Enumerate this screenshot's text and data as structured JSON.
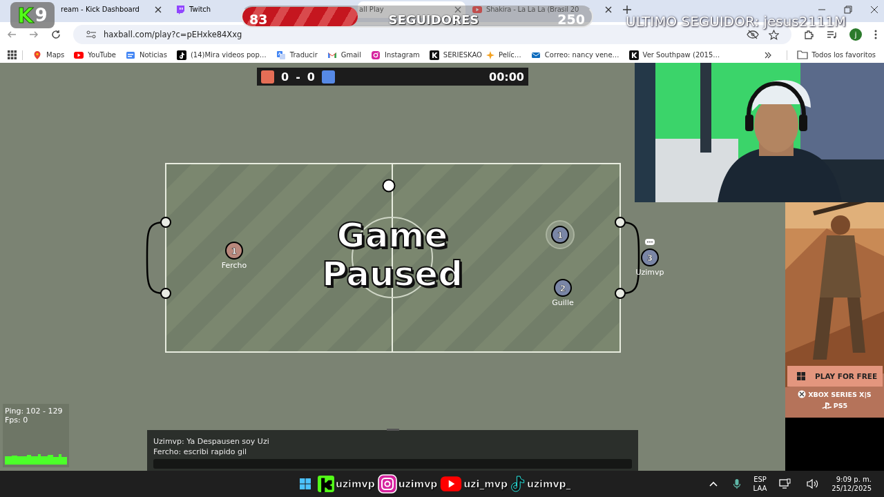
{
  "browser": {
    "tabs": [
      {
        "label": "ream - Kick Dashboard",
        "selected": false,
        "closable": true
      },
      {
        "label": "Twitch",
        "kind": "twitch",
        "selected": false,
        "closable": false
      },
      {
        "label": "all Play",
        "selected": true,
        "closable": true
      },
      {
        "label": "Shakira - La La La (Brasil 20",
        "kind": "youtube",
        "selected": false,
        "closable": true
      }
    ],
    "url": "haxball.com/play?c=pEHxke84Xxg",
    "profile_initial": "j",
    "bookmarks": [
      {
        "label": "Maps",
        "kind": "maps"
      },
      {
        "label": "YouTube",
        "kind": "youtube"
      },
      {
        "label": "Noticias",
        "kind": "news"
      },
      {
        "label": "(14)Mira videos pop…",
        "kind": "tiktok"
      },
      {
        "label": "Traducir",
        "kind": "translate"
      },
      {
        "label": "Gmail",
        "kind": "gmail"
      },
      {
        "label": "Instagram",
        "kind": "instagram"
      },
      {
        "label": "SERIESKAO",
        "label_2": "Pelíc…",
        "kind": "k"
      },
      {
        "label": "Correo: nancy vene…",
        "kind": "mail"
      },
      {
        "label": "Ver Southpaw (2015…",
        "kind": "k"
      }
    ],
    "all_bookmarks": "Todos los favoritos"
  },
  "game": {
    "score": {
      "red": "0",
      "separator": "-",
      "blue": "0",
      "time": "00:00"
    },
    "status": "Game Paused",
    "players": [
      {
        "kind": "red",
        "number": "1",
        "name": "Fercho",
        "highlighted": false,
        "typing": false
      },
      {
        "kind": "blue",
        "number": "1",
        "highlighted": true,
        "typing": false
      },
      {
        "kind": "blue",
        "number": "2",
        "name": "Guille",
        "highlighted": false,
        "typing": false
      },
      {
        "kind": "blue",
        "number": "3",
        "name": "Uzimvp",
        "highlighted": false,
        "typing": true
      }
    ],
    "stats": {
      "ping": "Ping: 102 - 129",
      "fps": "Fps: 0"
    },
    "chat": {
      "messages": [
        "Uzimvp: Ya Despausen soy Uzi",
        "Fercho: escribi rapido gil"
      ]
    }
  },
  "overlay": {
    "logo": {
      "letter": "K",
      "number": "9"
    },
    "followers": {
      "current": "83",
      "label": "SEGUIDORES",
      "goal": "250",
      "level": 0.33
    },
    "last_follower": "ULTIMO SEGUIDOR: jesus2111M",
    "socials": [
      {
        "kind": "kick",
        "handle": "uzimvp"
      },
      {
        "kind": "instagram",
        "handle": "uzimvp"
      },
      {
        "kind": "youtube",
        "handle": "uzi_mvp"
      },
      {
        "kind": "tiktok",
        "handle": "uzimvp_"
      }
    ]
  },
  "ad": {
    "button": "PLAY FOR FREE",
    "platforms": [
      "XBOX SERIES X|S",
      "PS5"
    ]
  },
  "taskbar": {
    "language": "ESP",
    "layout": "LAA",
    "time": "9:09 p. m.",
    "date": "25/12/2025"
  }
}
